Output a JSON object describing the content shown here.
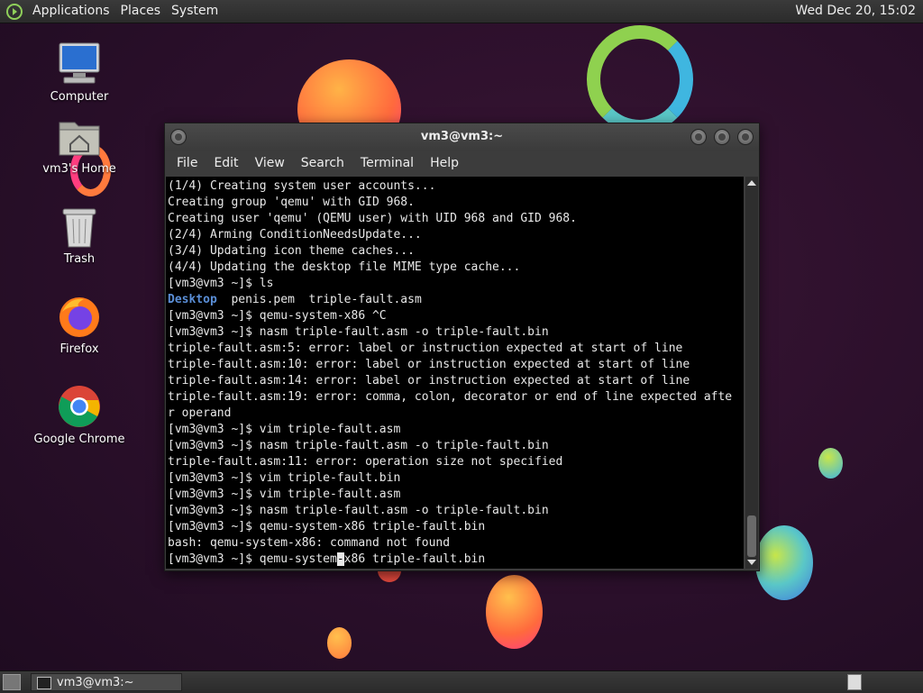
{
  "top_panel": {
    "menus": [
      "Applications",
      "Places",
      "System"
    ],
    "clock": "Wed Dec 20, 15:02"
  },
  "desktop_icons": [
    {
      "label": "Computer",
      "icon": "computer-icon"
    },
    {
      "label": "vm3's Home",
      "icon": "home-folder-icon"
    },
    {
      "label": "Trash",
      "icon": "trash-icon"
    },
    {
      "label": "Firefox",
      "icon": "firefox-icon"
    },
    {
      "label": "Google Chrome",
      "icon": "chrome-icon"
    }
  ],
  "window": {
    "title": "vm3@vm3:~",
    "menus": [
      "File",
      "Edit",
      "View",
      "Search",
      "Terminal",
      "Help"
    ]
  },
  "terminal": {
    "lines": [
      "(1/4) Creating system user accounts...",
      "Creating group 'qemu' with GID 968.",
      "Creating user 'qemu' (QEMU user) with UID 968 and GID 968.",
      "(2/4) Arming ConditionNeedsUpdate...",
      "(3/4) Updating icon theme caches...",
      "(4/4) Updating the desktop file MIME type cache...",
      "[vm3@vm3 ~]$ ls",
      "",
      "[vm3@vm3 ~]$ qemu-system-x86 ^C",
      "[vm3@vm3 ~]$ nasm triple-fault.asm -o triple-fault.bin",
      "triple-fault.asm:5: error: label or instruction expected at start of line",
      "triple-fault.asm:10: error: label or instruction expected at start of line",
      "triple-fault.asm:14: error: label or instruction expected at start of line",
      "triple-fault.asm:19: error: comma, colon, decorator or end of line expected afte",
      "r operand",
      "[vm3@vm3 ~]$ vim triple-fault.asm",
      "[vm3@vm3 ~]$ nasm triple-fault.asm -o triple-fault.bin",
      "triple-fault.asm:11: error: operation size not specified",
      "[vm3@vm3 ~]$ vim triple-fault.bin",
      "[vm3@vm3 ~]$ vim triple-fault.asm",
      "[vm3@vm3 ~]$ nasm triple-fault.asm -o triple-fault.bin",
      "[vm3@vm3 ~]$ qemu-system-x86 triple-fault.bin",
      "bash: qemu-system-x86: command not found"
    ],
    "ls_dir": "Desktop",
    "ls_files": "  penis.pem  triple-fault.asm",
    "prompt_before_cursor": "[vm3@vm3 ~]$ qemu-system",
    "cursor_char": "-",
    "prompt_after_cursor": "x86 triple-fault.bin"
  },
  "taskbar": {
    "task_label": "vm3@vm3:~"
  }
}
